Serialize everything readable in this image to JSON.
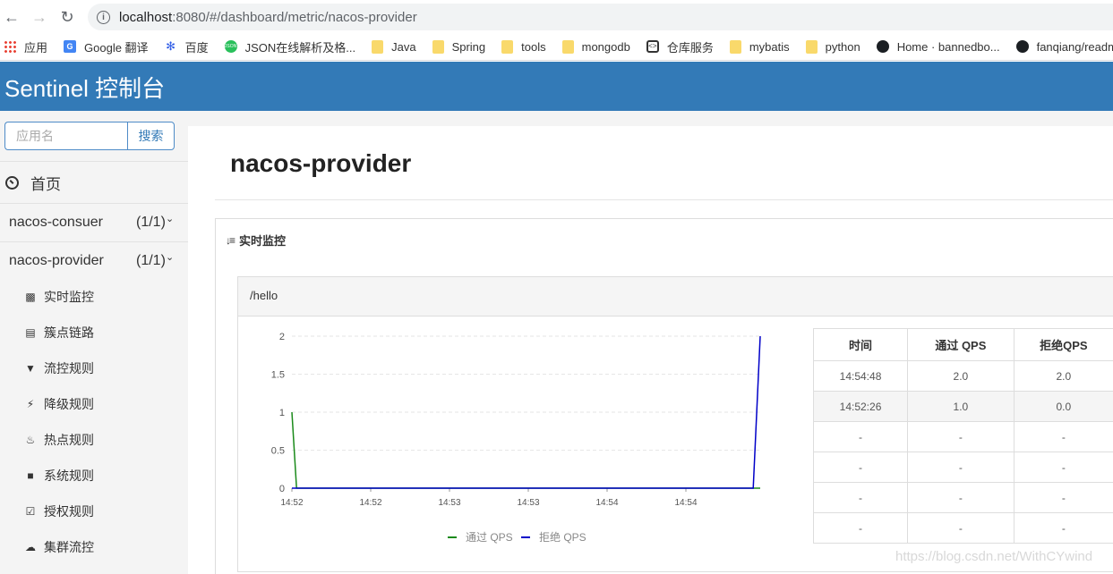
{
  "browser": {
    "url_host": "localhost",
    "url_path": ":8080/#/dashboard/metric/nacos-provider",
    "back_icon": "arrow-left-icon",
    "forward_icon": "arrow-right-icon",
    "reload_icon": "reload-icon",
    "bookmarks": [
      {
        "label": "应用",
        "icon": "apps-icon"
      },
      {
        "label": "Google 翻译",
        "icon": "google-translate-icon"
      },
      {
        "label": "百度",
        "icon": "baidu-icon"
      },
      {
        "label": "JSON在线解析及格...",
        "icon": "json-icon"
      },
      {
        "label": "Java",
        "icon": "folder-icon"
      },
      {
        "label": "Spring",
        "icon": "folder-icon"
      },
      {
        "label": "tools",
        "icon": "folder-icon"
      },
      {
        "label": "mongodb",
        "icon": "folder-icon"
      },
      {
        "label": "仓库服务",
        "icon": "code-icon"
      },
      {
        "label": "mybatis",
        "icon": "folder-icon"
      },
      {
        "label": "python",
        "icon": "folder-icon"
      },
      {
        "label": "Home · bannedbo...",
        "icon": "github-icon"
      },
      {
        "label": "fanqiang/readme...",
        "icon": "github-icon"
      }
    ]
  },
  "header": {
    "title": "Sentinel 控制台"
  },
  "sidebar": {
    "search_placeholder": "应用名",
    "search_button": "搜索",
    "home_label": "首页",
    "apps": [
      {
        "name": "nacos-consuer",
        "count": "(1/1)"
      },
      {
        "name": "nacos-provider",
        "count": "(1/1)"
      }
    ],
    "sub_items": [
      {
        "label": "实时监控",
        "icon": "bar-chart-icon"
      },
      {
        "label": "簇点链路",
        "icon": "list-icon"
      },
      {
        "label": "流控规则",
        "icon": "filter-icon"
      },
      {
        "label": "降级规则",
        "icon": "bolt-icon"
      },
      {
        "label": "热点规则",
        "icon": "fire-icon"
      },
      {
        "label": "系统规则",
        "icon": "lock-icon"
      },
      {
        "label": "授权规则",
        "icon": "check-square-icon"
      },
      {
        "label": "集群流控",
        "icon": "cloud-icon"
      }
    ]
  },
  "main": {
    "page_title": "nacos-provider",
    "panel_title": "实时监控",
    "resource": "/hello",
    "table": {
      "headers": [
        "时间",
        "通过 QPS",
        "拒绝QPS"
      ],
      "rows": [
        [
          "14:54:48",
          "2.0",
          "2.0"
        ],
        [
          "14:52:26",
          "1.0",
          "0.0"
        ],
        [
          "-",
          "-",
          "-"
        ],
        [
          "-",
          "-",
          "-"
        ],
        [
          "-",
          "-",
          "-"
        ],
        [
          "-",
          "-",
          "-"
        ]
      ]
    }
  },
  "chart_data": {
    "type": "line",
    "title": "",
    "xlabel": "",
    "ylabel": "",
    "x_tick_labels": [
      "14:52",
      "14:52",
      "14:53",
      "14:53",
      "14:54",
      "14:54"
    ],
    "y_ticks": [
      "0",
      "0.5",
      "1",
      "1.5",
      "2"
    ],
    "ylim": [
      0,
      2
    ],
    "grid": true,
    "legend_position": "bottom",
    "x": [
      0,
      0.01,
      0.985,
      1
    ],
    "series": [
      {
        "name": "通过 QPS",
        "color": "#1a8a1a",
        "values": [
          1,
          0,
          0,
          0
        ]
      },
      {
        "name": "拒绝 QPS",
        "color": "#0000c8",
        "values": [
          0,
          0,
          0,
          2
        ]
      }
    ]
  },
  "watermark": "https://blog.csdn.net/WithCYwind"
}
